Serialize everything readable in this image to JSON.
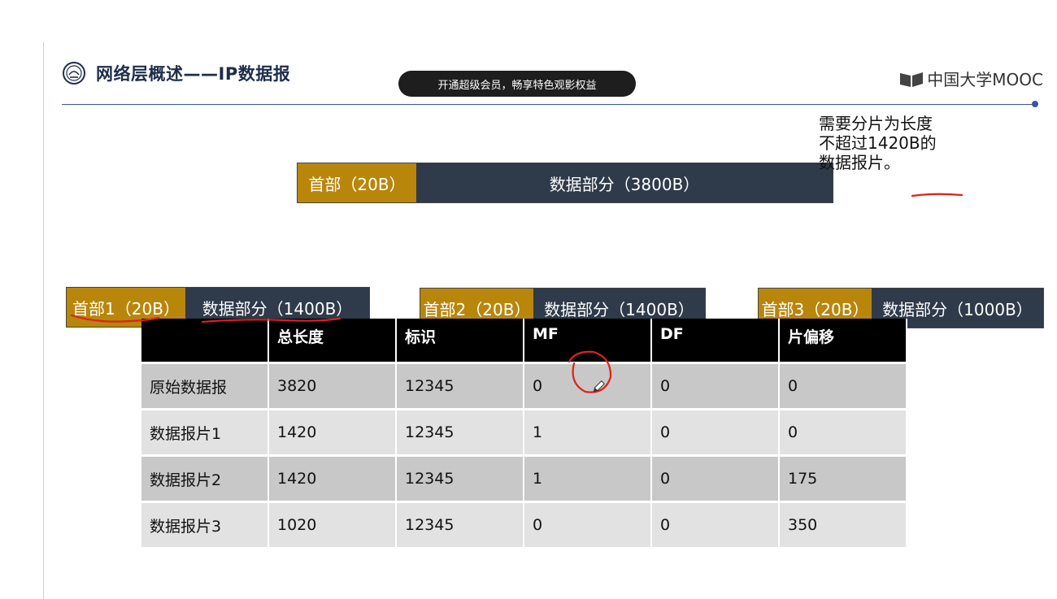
{
  "slide": {
    "title": "网络层概述——IP数据报",
    "brand": "中国大学MOOC",
    "vip_banner": "开通超级会员，畅享特色观影权益"
  },
  "original_packet": {
    "header": "首部（20B）",
    "data": "数据部分（3800B）"
  },
  "note": {
    "line1": "需要分片为长度",
    "line2": "不超过1420B的",
    "line3": "数据报片。"
  },
  "fragments": [
    {
      "header": "首部1（20B）",
      "data": "数据部分（1400B）"
    },
    {
      "header": "首部2（20B）",
      "data": "数据部分（1400B）"
    },
    {
      "header": "首部3（20B）",
      "data": "数据部分（1000B）"
    }
  ],
  "table": {
    "headers": [
      "",
      "总长度",
      "标识",
      "MF",
      "DF",
      "片偏移"
    ],
    "rows": [
      [
        "原始数据报",
        "3820",
        "12345",
        "0",
        "0",
        "0"
      ],
      [
        "数据报片1",
        "1420",
        "12345",
        "1",
        "0",
        "0"
      ],
      [
        "数据报片2",
        "1420",
        "12345",
        "1",
        "0",
        "175"
      ],
      [
        "数据报片3",
        "1020",
        "12345",
        "0",
        "0",
        "350"
      ]
    ]
  },
  "colors": {
    "header_gold": "#b8860b",
    "data_navy": "#2f3a4a",
    "annotation_red": "#e0201c",
    "rule_blue": "#3a55a0"
  },
  "icons": [
    "university-logo-icon",
    "mooc-book-icon",
    "pencil-cursor-icon"
  ]
}
